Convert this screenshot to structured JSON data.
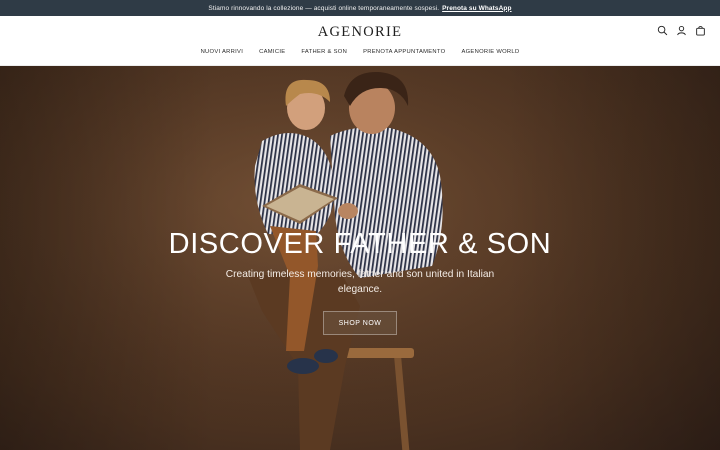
{
  "announcement": {
    "text": "Stiamo rinnovando la collezione — acquisti online temporaneamente sospesi.",
    "link": "Prenota su WhatsApp"
  },
  "header": {
    "logo": "AGENORIE",
    "icons": [
      "search-icon",
      "account-icon",
      "cart-icon"
    ]
  },
  "nav": {
    "items": [
      {
        "label": "NUOVI ARRIVI"
      },
      {
        "label": "CAMICIE"
      },
      {
        "label": "FATHER & SON"
      },
      {
        "label": "PRENOTA APPUNTAMENTO"
      },
      {
        "label": "AGENORIE WORLD"
      }
    ]
  },
  "hero": {
    "title": "DISCOVER FATHER & SON",
    "subtitle": "Creating timeless memories, father and son united in Italian elegance.",
    "button": "SHOP NOW"
  },
  "colors": {
    "announcement_bg": "#2f3b46",
    "hero_bg": "#5a3c27"
  }
}
